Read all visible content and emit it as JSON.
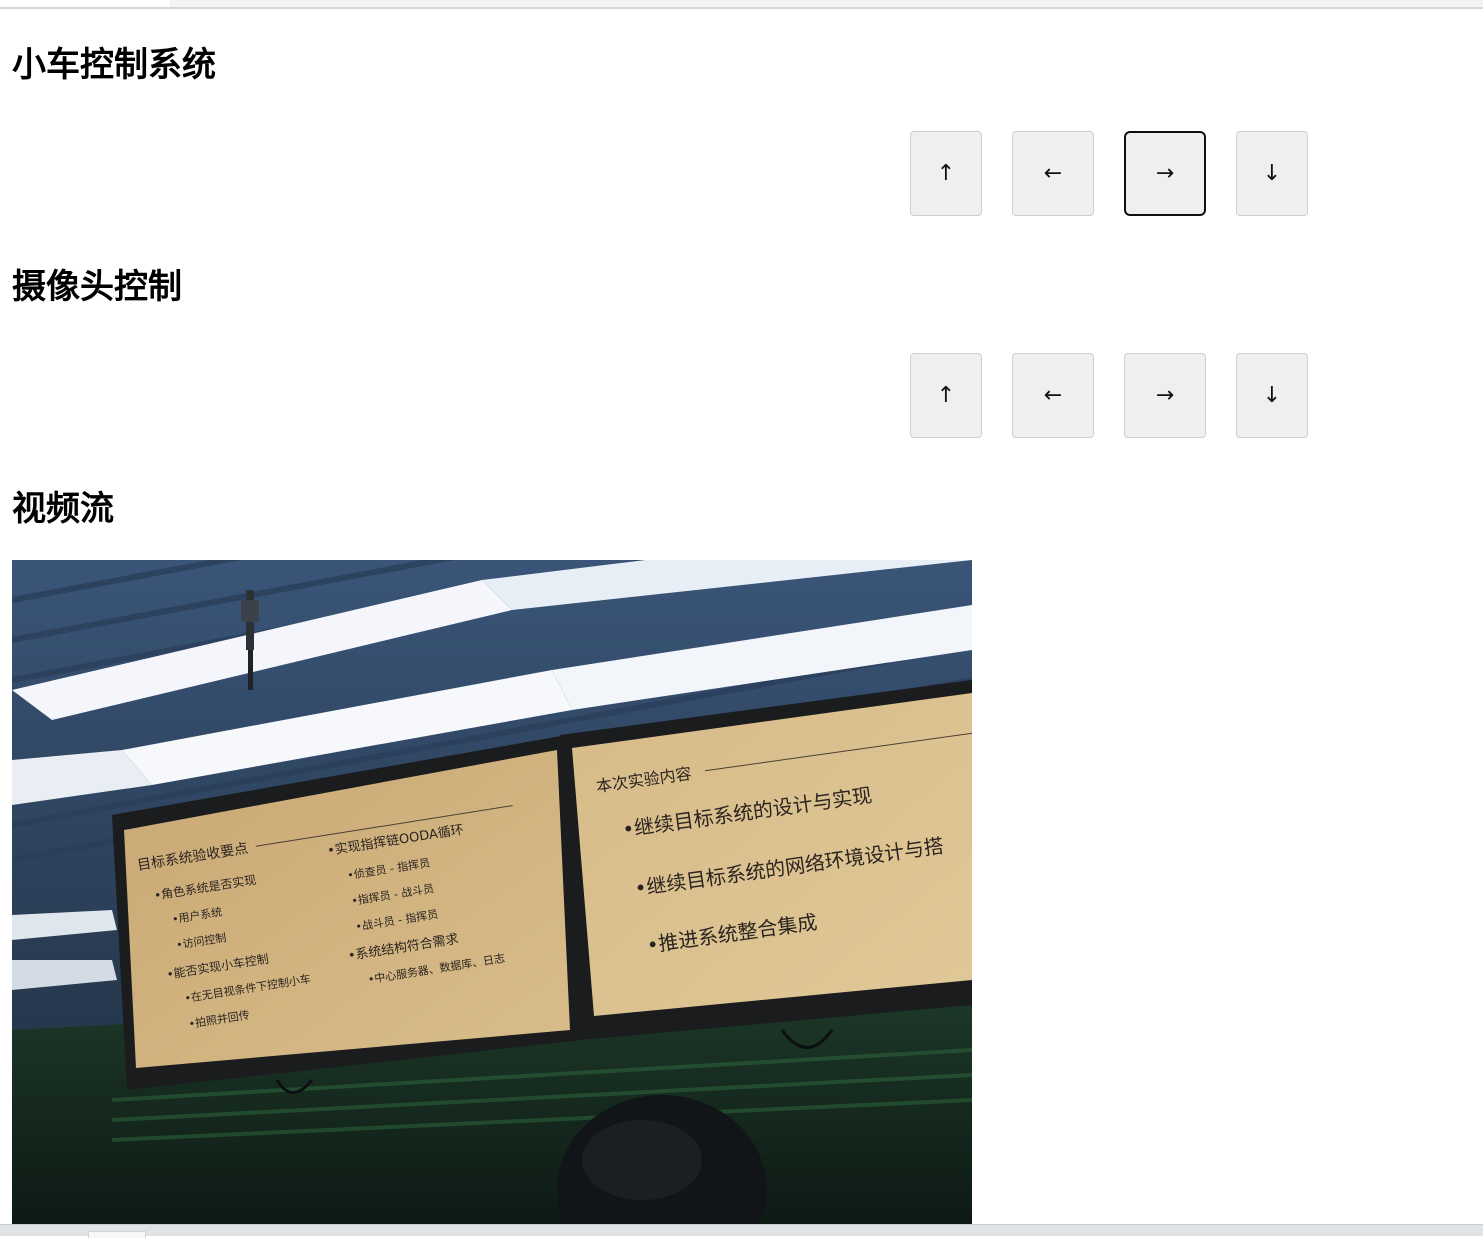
{
  "car_control": {
    "title": "小车控制系统",
    "buttons": {
      "up": "↑",
      "left": "←",
      "right": "→",
      "down": "↓"
    }
  },
  "camera_control": {
    "title": "摄像头控制",
    "buttons": {
      "up": "↑",
      "left": "←",
      "right": "→",
      "down": "↓"
    }
  },
  "video": {
    "title": "视频流",
    "left_slide": {
      "heading": "目标系统验收要点",
      "col1": [
        "•角色系统是否实现",
        "•用户系统",
        "•访问控制",
        "•能否实现小车控制",
        "•在无目视条件下控制小车",
        "•拍照并回传"
      ],
      "col2": [
        "•实现指挥链OODA循环",
        "•侦查员 - 指挥员",
        "•指挥员 - 战斗员",
        "•战斗员 - 指挥员",
        "•系统结构符合需求",
        "•中心服务器、数据库、日志"
      ]
    },
    "right_slide": {
      "heading": "本次实验内容",
      "items": [
        "•继续目标系统的设计与实现",
        "•继续目标系统的网络环境设计与搭",
        "•推进系统整合集成"
      ]
    }
  },
  "colors": {
    "button_bg": "#efefef",
    "button_border": "#cfcfcf",
    "focus_border": "#101010"
  }
}
